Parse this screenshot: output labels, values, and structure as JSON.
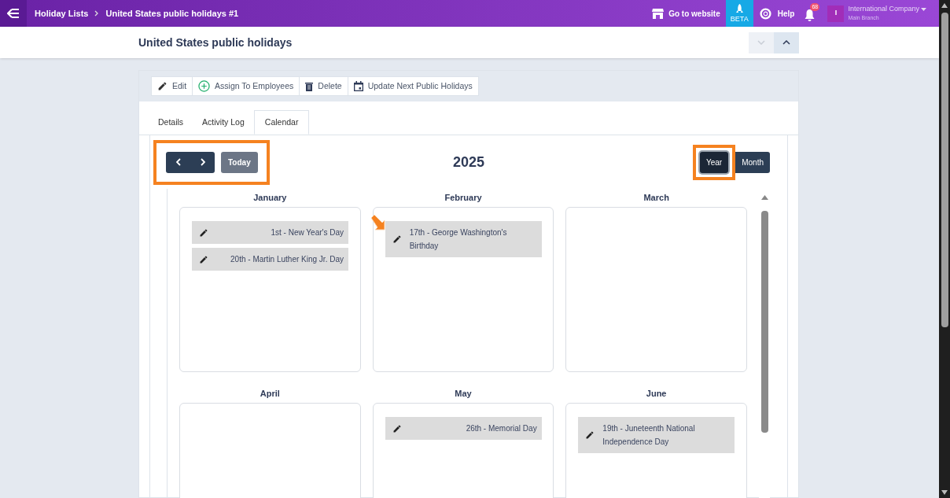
{
  "topbar": {
    "breadcrumb": [
      "Holiday Lists",
      "United States public holidays #1"
    ],
    "website_link": "Go to website",
    "beta": "BETA",
    "help": "Help",
    "notifications": "68",
    "avatar": "I",
    "company": "International Company",
    "branch": "Main Branch"
  },
  "header": {
    "title": "United States public holidays",
    "collapse_down_disabled": true
  },
  "toolbar": [
    {
      "kind": "edit",
      "label": "Edit"
    },
    {
      "kind": "assign",
      "label": "Assign To Employees"
    },
    {
      "kind": "delete",
      "label": "Delete"
    },
    {
      "kind": "calendar",
      "label": "Update Next Public Holidays"
    }
  ],
  "tabs": [
    {
      "label": "Details",
      "selected": false
    },
    {
      "label": "Activity Log",
      "selected": false
    },
    {
      "label": "Calendar",
      "selected": true
    }
  ],
  "calendar": {
    "nav": {
      "today": "Today",
      "highlighted": true
    },
    "year": "2025",
    "views": [
      {
        "label": "Year",
        "selected": true,
        "highlighted": true
      },
      {
        "label": "Month",
        "selected": false,
        "highlighted": false
      }
    ],
    "months": [
      {
        "name": "January",
        "holidays": [
          {
            "text": "1st - New Year's Day",
            "pointer": false
          },
          {
            "text": "20th - Martin Luther King Jr. Day",
            "pointer": false
          }
        ]
      },
      {
        "name": "February",
        "holidays": [
          {
            "text": "17th - George Washington's Birthday",
            "pointer": true
          }
        ]
      },
      {
        "name": "March"
      },
      {
        "name": "April"
      },
      {
        "name": "May",
        "holidays": [
          {
            "text": "26th - Memorial Day",
            "pointer": false
          }
        ]
      },
      {
        "name": "June",
        "holidays": [
          {
            "text": "19th - Juneteenth National Independence Day",
            "pointer": false
          }
        ]
      }
    ]
  }
}
